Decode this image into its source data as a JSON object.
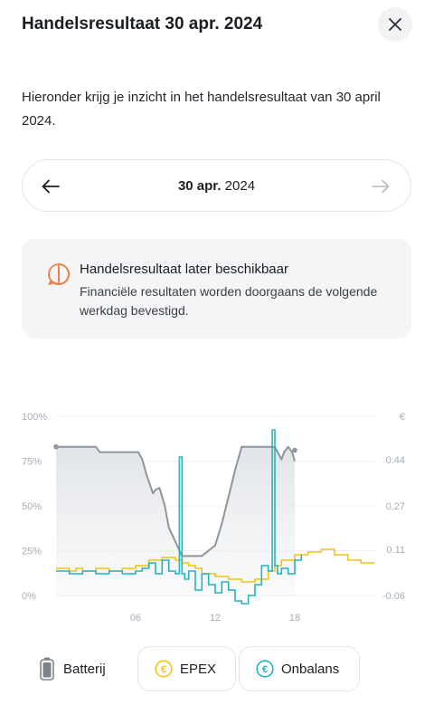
{
  "header": {
    "title": "Handelsresultaat 30 apr. 2024",
    "close_icon": "close-icon"
  },
  "intro": {
    "text": "Hieronder krijg je inzicht in het handelsresultaat van 30 april 2024."
  },
  "date_nav": {
    "day_month": "30 apr.",
    "year": "2024",
    "prev_icon": "arrow-left-icon",
    "next_icon": "arrow-right-icon"
  },
  "notice": {
    "icon": "alert-icon",
    "title": "Handelsresultaat later beschikbaar",
    "body": "Financiële resultaten worden doorgaans de volgende werkdag bevestigd.",
    "accent_color": "#ee7d45"
  },
  "chart_data": {
    "type": "line",
    "x_ticks": [
      "06",
      "12",
      "18"
    ],
    "y_left_ticks": [
      "100%",
      "75%",
      "50%",
      "25%",
      "0%"
    ],
    "y_right_unit": "€",
    "y_right_ticks": [
      "0.44",
      "0.27",
      "0.11",
      "-0.06"
    ],
    "xlim": [
      0,
      24
    ],
    "ylim_left": [
      0,
      100
    ],
    "ylim_right": [
      -0.06,
      0.6
    ],
    "grid": true,
    "series": [
      {
        "name": "Batterij",
        "axis": "left",
        "color": "#8e959c",
        "x": [
          0,
          0.2,
          1.5,
          3,
          3.3,
          6.2,
          6.5,
          6.8,
          7.3,
          7.5,
          7.8,
          8.2,
          8.5,
          9.0,
          9.5,
          10.0,
          10.5,
          11.0,
          12.0,
          12.5,
          13.0,
          13.5,
          14.0,
          14.5,
          15.0,
          16.0,
          16.5,
          17.0,
          17.2,
          17.5,
          17.8,
          18.0
        ],
        "values": [
          83,
          83,
          83,
          83,
          80,
          80,
          76,
          68,
          57,
          59,
          60,
          50,
          38,
          30,
          22,
          22,
          22,
          22,
          28,
          40,
          55,
          70,
          83,
          83,
          83,
          83,
          83,
          76,
          80,
          83,
          80,
          75
        ]
      },
      {
        "name": "EPEX",
        "axis": "right",
        "color": "#f0c419",
        "x": [
          0,
          1,
          1.5,
          2,
          3,
          4,
          5,
          6,
          7,
          8,
          9,
          9.5,
          10,
          10.5,
          11,
          12,
          13,
          14,
          15,
          16,
          16.5,
          17,
          18,
          19,
          20,
          21,
          22,
          23,
          24
        ],
        "values": [
          0.04,
          0.03,
          0.04,
          0.03,
          0.04,
          0.03,
          0.04,
          0.05,
          0.07,
          0.08,
          0.07,
          0.06,
          0.05,
          0.04,
          0.02,
          0.01,
          0.0,
          -0.01,
          0.0,
          0.03,
          0.05,
          0.07,
          0.09,
          0.1,
          0.11,
          0.09,
          0.07,
          0.06,
          0.06
        ]
      },
      {
        "name": "Onbalans",
        "axis": "right",
        "color": "#23b4c4",
        "x": [
          0,
          1,
          2,
          3,
          4,
          5,
          6,
          6.5,
          7,
          7.5,
          8,
          8.5,
          9,
          9.3,
          9.5,
          9.7,
          10,
          10.5,
          11,
          11.5,
          12,
          12.5,
          13,
          13.5,
          14,
          14.5,
          15,
          15.5,
          16,
          16.3,
          16.5,
          16.7,
          17,
          17.5,
          18,
          18.5
        ],
        "values": [
          0.03,
          0.02,
          0.03,
          0.02,
          0.03,
          0.02,
          0.03,
          0.04,
          0.06,
          0.02,
          0.07,
          0.03,
          0.02,
          0.45,
          0.02,
          0.0,
          0.03,
          -0.04,
          0.02,
          -0.02,
          -0.05,
          -0.01,
          -0.04,
          -0.08,
          -0.09,
          -0.06,
          -0.02,
          0.05,
          0.03,
          0.55,
          0.05,
          0.02,
          0.04,
          0.02,
          0.07,
          0.09
        ]
      }
    ]
  },
  "legend": {
    "batterij": {
      "label": "Batterij",
      "icon": "battery-icon",
      "selected": true
    },
    "epex": {
      "label": "EPEX",
      "icon": "euro-coin-icon",
      "color": "#f0c419",
      "selected": false
    },
    "onbalans": {
      "label": "Onbalans",
      "icon": "euro-coin-icon",
      "color": "#23b4c4",
      "selected": false
    }
  }
}
